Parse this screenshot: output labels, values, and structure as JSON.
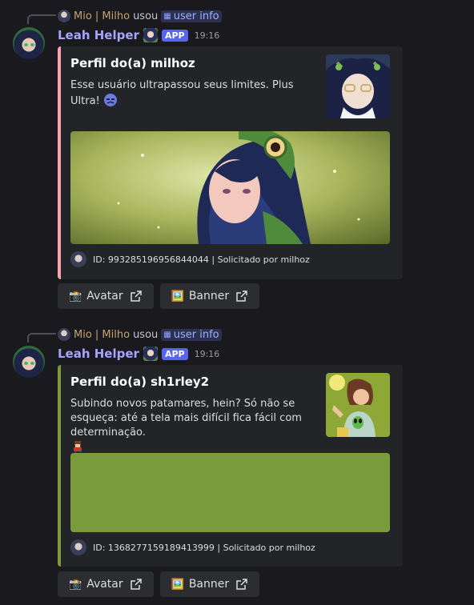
{
  "messages": [
    {
      "reply_user": "Mio | Milho",
      "reply_used": "usou",
      "reply_command": "user info",
      "bot_name": "Leah Helper",
      "app_tag": "APP",
      "time": "19:16",
      "embed": {
        "accent": "#f4a7b3",
        "title": "Perfil do(a) milhoz",
        "description": "Esse usuário ultrapassou seus limites. Plus Ultra!",
        "footer": "ID: 993285196956844044 | Solicitado por milhoz"
      },
      "buttons": [
        {
          "emoji": "📸",
          "label": "Avatar"
        },
        {
          "emoji": "🖼️",
          "label": "Banner"
        }
      ]
    },
    {
      "reply_user": "Mio | Milho",
      "reply_used": "usou",
      "reply_command": "user info",
      "bot_name": "Leah Helper",
      "app_tag": "APP",
      "time": "19:16",
      "embed": {
        "accent": "#7a9a3c",
        "title": "Perfil do(a) sh1rley2",
        "description": "Subindo novos patamares, hein? Só não se esqueça: até a tela mais difícil fica fácil com determinação.",
        "footer": "ID: 1368277159189413999 | Solicitado por milhoz",
        "banner_color": "#7a9a3c"
      },
      "buttons": [
        {
          "emoji": "📸",
          "label": "Avatar"
        },
        {
          "emoji": "🖼️",
          "label": "Banner"
        }
      ]
    }
  ]
}
